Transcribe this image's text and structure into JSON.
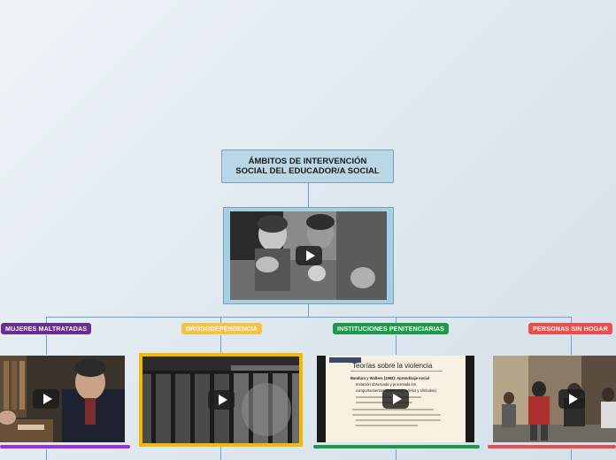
{
  "root": {
    "title_line1": "ÁMBITOS DE INTERVENCIÓN",
    "title_line2": "SOCIAL DEL EDUCADOR/A SOCIAL"
  },
  "branches": [
    {
      "label": "MUJERES MALTRATADAS",
      "color": "#6a2d91"
    },
    {
      "label": "DROGODEPENDENCIA",
      "color": "#f5c243"
    },
    {
      "label": "INSTITUCIONES PENITENCIARIAS",
      "color": "#1b9a4b"
    },
    {
      "label": "PERSONAS SIN HOGAR",
      "color": "#ec4c4c"
    }
  ],
  "slide": {
    "title": "Teorías sobre la violencia",
    "bullet1": "Bandura y Walters (1963): Aprendizaje social",
    "line2": "Imitación observada y procesada los",
    "line3": "comportamientos violentos (modelos y símbolos)"
  },
  "colors": {
    "connector": "#6f9fd8",
    "mujeres_underline": "#9b30e0",
    "drogo_border": "#f5b800",
    "inst_underline": "#1b9a4b",
    "sinhogar_underline": "#ec4c4c"
  }
}
